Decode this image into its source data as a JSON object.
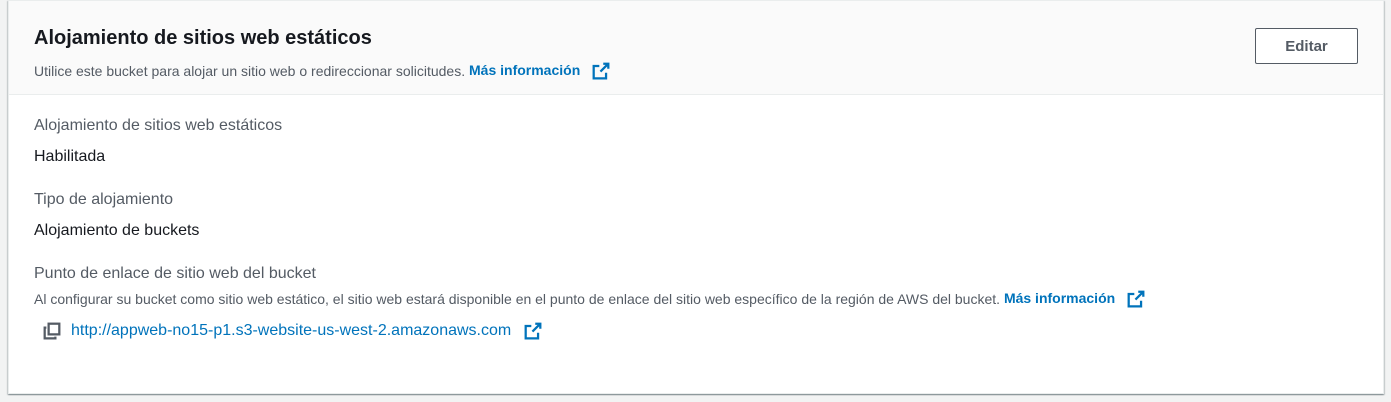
{
  "header": {
    "title": "Alojamiento de sitios web estáticos",
    "description": "Utilice este bucket para alojar un sitio web o redireccionar solicitudes.",
    "more_info_label": "Más información",
    "edit_label": "Editar"
  },
  "fields": {
    "hosting": {
      "label": "Alojamiento de sitios web estáticos",
      "value": "Habilitada"
    },
    "hosting_type": {
      "label": "Tipo de alojamiento",
      "value": "Alojamiento de buckets"
    },
    "endpoint": {
      "label": "Punto de enlace de sitio web del bucket",
      "help": "Al configurar su bucket como sitio web estático, el sitio web estará disponible en el punto de enlace del sitio web específico de la región de AWS del bucket.",
      "more_info_label": "Más información",
      "url": "http://appweb-no15-p1.s3-website-us-west-2.amazonaws.com"
    }
  },
  "icons": {
    "external": "external-link-icon",
    "copy": "copy-icon"
  },
  "colors": {
    "link": "#0073bb",
    "text": "#16191f",
    "secondary_text": "#545b64",
    "header_bg": "#fafafa"
  }
}
